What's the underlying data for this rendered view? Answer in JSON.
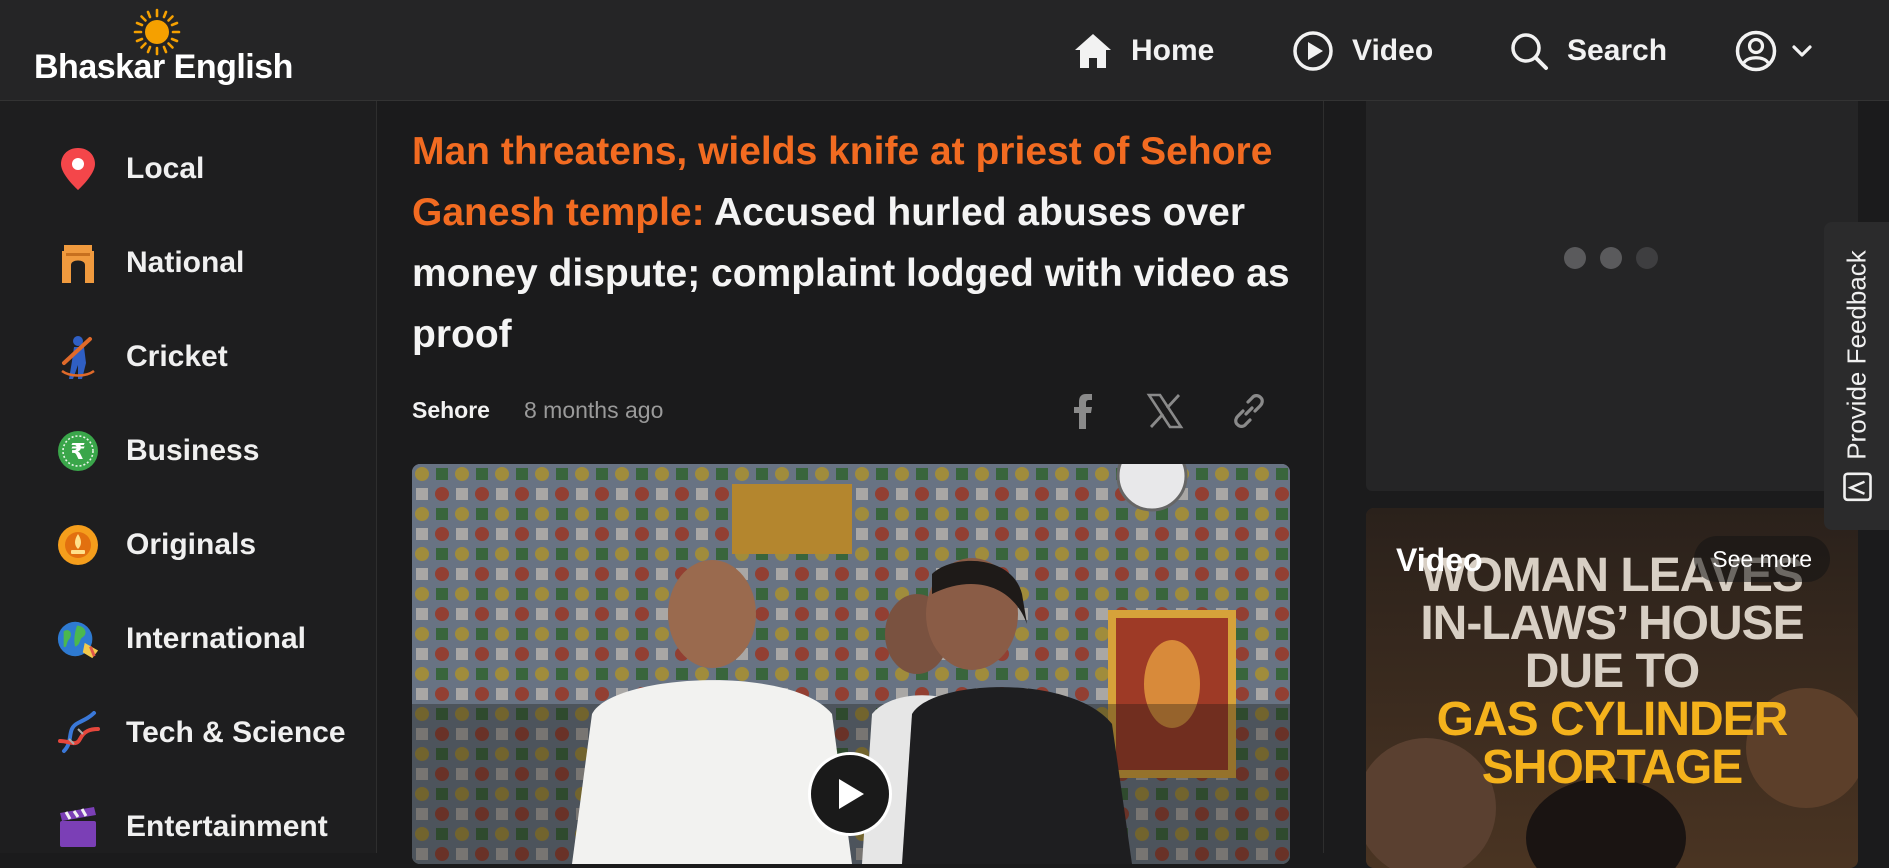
{
  "header": {
    "logo_text": "Bhaskar English",
    "nav": [
      {
        "label": "Home",
        "icon": "home-icon"
      },
      {
        "label": "Video",
        "icon": "play-circle-icon"
      },
      {
        "label": "Search",
        "icon": "search-icon"
      }
    ],
    "profile_icon": "user-circle-icon",
    "dropdown_icon": "chevron-down-icon"
  },
  "sidebar": {
    "items": [
      {
        "label": "Local",
        "icon": "location-pin-icon"
      },
      {
        "label": "National",
        "icon": "india-gate-icon"
      },
      {
        "label": "Cricket",
        "icon": "cricketer-icon"
      },
      {
        "label": "Business",
        "icon": "rupee-coin-icon"
      },
      {
        "label": "Originals",
        "icon": "originals-badge-icon"
      },
      {
        "label": "International",
        "icon": "globe-icon"
      },
      {
        "label": "Tech & Science",
        "icon": "dna-icon"
      },
      {
        "label": "Entertainment",
        "icon": "clapperboard-icon"
      }
    ]
  },
  "article": {
    "headline_accent": "Man threatens, wields knife at priest of Sehore Ganesh temple:",
    "headline_rest": " Accused hurled abuses over money dispute; complaint lodged with video as proof",
    "location": "Sehore",
    "time_ago": "8 months ago",
    "share": [
      "facebook-icon",
      "x-icon",
      "link-icon"
    ]
  },
  "video_widget": {
    "title": "Video",
    "see_more": "See more",
    "thumbnail_lines": [
      {
        "text": "WOMAN LEAVES",
        "style": "w"
      },
      {
        "text": "IN-LAWS’ HOUSE",
        "style": "w"
      },
      {
        "text": "DUE TO",
        "style": "w"
      },
      {
        "text": "GAS CYLINDER",
        "style": "y"
      },
      {
        "text": "SHORTAGE",
        "style": "y"
      }
    ]
  },
  "feedback": {
    "label": "Provide Feedback"
  },
  "colors": {
    "accent": "#f26b21",
    "background": "#1b1b1c",
    "header_bg": "#252526",
    "headline_yellow": "#f4b21c"
  }
}
